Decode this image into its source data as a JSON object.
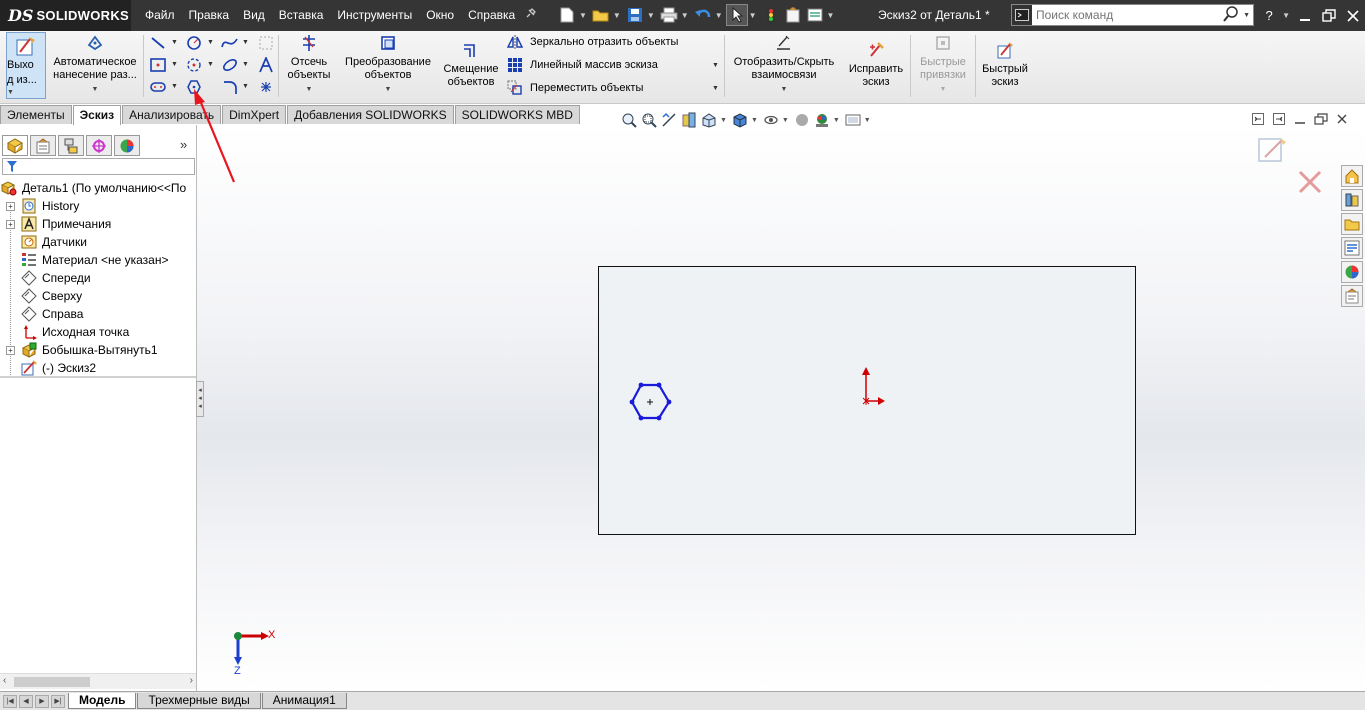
{
  "app": {
    "brand": "SOLIDWORKS",
    "brand_prefix": "DS",
    "document_title": "Эскиз2 от Деталь1 *"
  },
  "menu": [
    "Файл",
    "Правка",
    "Вид",
    "Вставка",
    "Инструменты",
    "Окно",
    "Справка"
  ],
  "search": {
    "placeholder": "Поиск команд"
  },
  "ribbon": {
    "exit_sketch": "Выхо\nд из...",
    "smart_dimension": "Автоматическое\nнанесение раз...",
    "trim": "Отсечь\nобъекты",
    "convert": "Преобразование\nобъектов",
    "offset": "Смещение\nобъектов",
    "mirror": "Зеркально отразить объекты",
    "linear_pattern": "Линейный массив эскиза",
    "move": "Переместить объекты",
    "display_relations": "Отобразить/Скрыть\nвзаимосвязи",
    "repair": "Исправить\nэскиз",
    "quick_snaps": "Быстрые\nпривязки",
    "rapid_sketch": "Быстрый\nэскиз"
  },
  "cm_tabs": [
    {
      "label": "Элементы",
      "active": false
    },
    {
      "label": "Эскиз",
      "active": true
    },
    {
      "label": "Анализировать",
      "active": false
    },
    {
      "label": "DimXpert",
      "active": false
    },
    {
      "label": "Добавления SOLIDWORKS",
      "active": false
    },
    {
      "label": "SOLIDWORKS MBD",
      "active": false
    }
  ],
  "tree": {
    "root": "Деталь1  (По умолчанию<<По",
    "items": [
      {
        "label": "History",
        "icon": "history-icon",
        "expandable": true
      },
      {
        "label": "Примечания",
        "icon": "annotations-icon",
        "expandable": true
      },
      {
        "label": "Датчики",
        "icon": "sensors-icon",
        "expandable": false
      },
      {
        "label": "Материал <не указан>",
        "icon": "material-icon",
        "expandable": false
      },
      {
        "label": "Спереди",
        "icon": "plane-icon",
        "expandable": false
      },
      {
        "label": "Сверху",
        "icon": "plane-icon",
        "expandable": false
      },
      {
        "label": "Справа",
        "icon": "plane-icon",
        "expandable": false
      },
      {
        "label": "Исходная точка",
        "icon": "origin-icon",
        "expandable": false
      },
      {
        "label": "Бобышка-Вытянуть1",
        "icon": "boss-extrude-icon",
        "expandable": true
      },
      {
        "label": "(-) Эскиз2",
        "icon": "sketch-icon",
        "expandable": false
      }
    ]
  },
  "triad": {
    "x": "X",
    "z": "Z"
  },
  "bottom_tabs": [
    {
      "label": "Модель",
      "active": true
    },
    {
      "label": "Трехмерные виды",
      "active": false
    },
    {
      "label": "Анимация1",
      "active": false
    }
  ],
  "colors": {
    "menubar": "#353535",
    "sketch_blue": "#1a1adb",
    "origin_red": "#d00000",
    "annotation_arrow": "#e8141e"
  }
}
